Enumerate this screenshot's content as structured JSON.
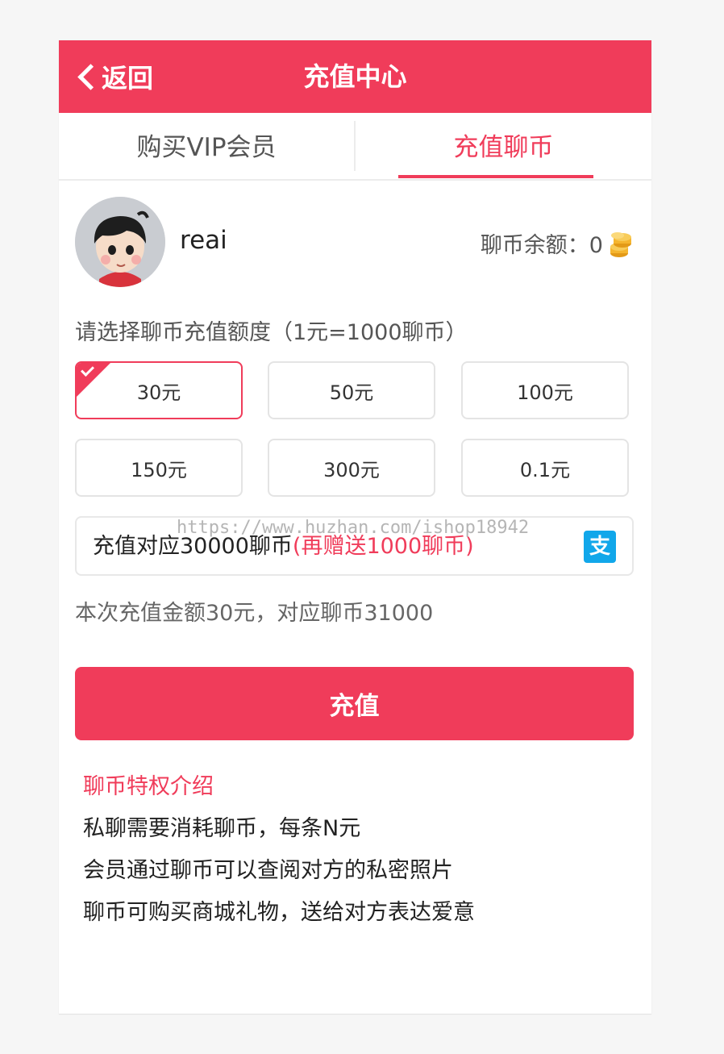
{
  "header": {
    "back_label": "返回",
    "title": "充值中心"
  },
  "tabs": [
    {
      "label": "购买VIP会员",
      "active": false
    },
    {
      "label": "充值聊币",
      "active": true
    }
  ],
  "user": {
    "name": "reai",
    "balance_label": "聊币余额：0"
  },
  "select_prompt": "请选择聊币充值额度（1元=1000聊币）",
  "options": [
    {
      "label": "30元",
      "selected": true
    },
    {
      "label": "50元",
      "selected": false
    },
    {
      "label": "100元",
      "selected": false
    },
    {
      "label": "150元",
      "selected": false
    },
    {
      "label": "300元",
      "selected": false
    },
    {
      "label": "0.1元",
      "selected": false
    }
  ],
  "amount": {
    "main": "充值对应30000聊币",
    "bonus": "(再赠送1000聊币)",
    "pay_icon": "alipay-icon"
  },
  "watermark": "https://www.huzhan.com/ishop18942",
  "summary": "本次充值金额30元，对应聊币31000",
  "recharge_label": "充值",
  "intro": {
    "title": "聊币特权介绍",
    "lines": [
      "私聊需要消耗聊币，每条N元",
      "会员通过聊币可以查阅对方的私密照片",
      "聊币可购买商城礼物，送给对方表达爱意"
    ]
  },
  "colors": {
    "accent": "#f03c5a",
    "alipay": "#11a7ea",
    "coin": "#f5b52e"
  }
}
